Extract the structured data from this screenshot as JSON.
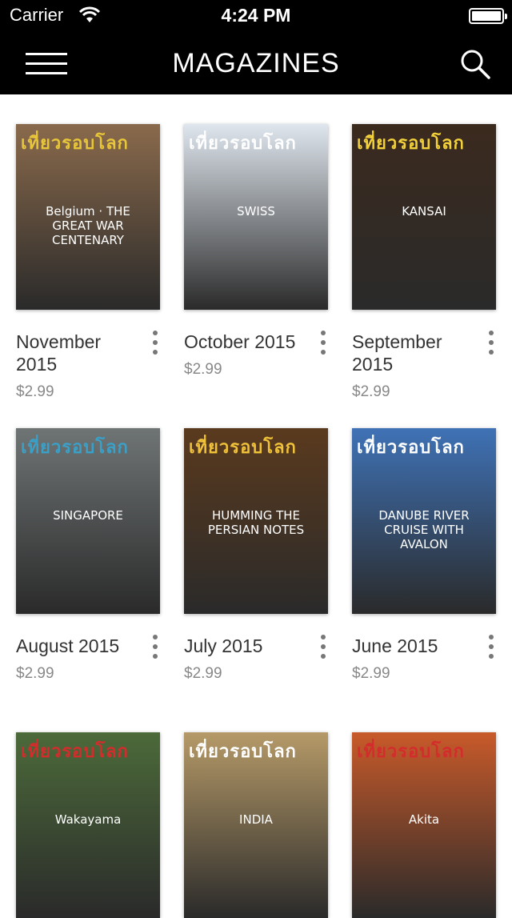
{
  "status_bar": {
    "carrier": "Carrier",
    "time": "4:24 PM"
  },
  "nav": {
    "title": "MAGAZINES",
    "menu_icon": "hamburger-icon",
    "search_icon": "search-icon"
  },
  "magazines": [
    {
      "title": "November 2015",
      "price": "$2.99",
      "masthead": "เที่ยวรอบโลก",
      "cover_text": "Belgium · THE GREAT WAR CENTENARY",
      "mast_color": "#e8c63a",
      "bg": "#8a6a4c"
    },
    {
      "title": "October 2015",
      "price": "$2.99",
      "masthead": "เที่ยวรอบโลก",
      "cover_text": "SWISS",
      "mast_color": "#ffffff",
      "bg": "#dfe6ee"
    },
    {
      "title": "September 2015",
      "price": "$2.99",
      "masthead": "เที่ยวรอบโลก",
      "cover_text": "KANSAI",
      "mast_color": "#f3d13a",
      "bg": "#3b2a1e"
    },
    {
      "title": "August 2015",
      "price": "$2.99",
      "masthead": "เที่ยวรอบโลก",
      "cover_text": "SINGAPORE",
      "mast_color": "#3aa0c8",
      "bg": "#6f7475"
    },
    {
      "title": "July 2015",
      "price": "$2.99",
      "masthead": "เที่ยวรอบโลก",
      "cover_text": "HUMMING THE PERSIAN NOTES",
      "mast_color": "#f0c23a",
      "bg": "#5a3a1e"
    },
    {
      "title": "June 2015",
      "price": "$2.99",
      "masthead": "เที่ยวรอบโลก",
      "cover_text": "DANUBE RIVER CRUISE WITH AVALON",
      "mast_color": "#ffffff",
      "bg": "#3f72b6"
    },
    {
      "title": "",
      "price": "",
      "masthead": "เที่ยวรอบโลก",
      "cover_text": "Wakayama",
      "mast_color": "#d42c2c",
      "bg": "#4c6a3a"
    },
    {
      "title": "",
      "price": "",
      "masthead": "เที่ยวรอบโลก",
      "cover_text": "INDIA",
      "mast_color": "#ffffff",
      "bg": "#b69a68"
    },
    {
      "title": "",
      "price": "",
      "masthead": "เที่ยวรอบโลก",
      "cover_text": "Akita",
      "mast_color": "#d42c2c",
      "bg": "#c85a2a"
    }
  ]
}
